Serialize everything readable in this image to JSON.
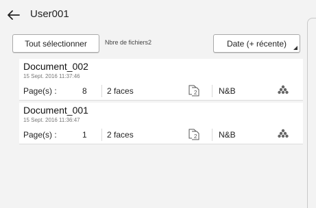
{
  "header": {
    "title": "User001",
    "back_icon": "arrow-left-icon"
  },
  "toolbar": {
    "select_all_label": "Tout sélectionner",
    "file_count_label": "Nbre de fichiers2",
    "sort_label": "Date (+ récente)"
  },
  "documents": [
    {
      "name": "Document_002",
      "date": "15 Sept. 2016 11:37:46",
      "pages_label": "Page(s) :",
      "pages": "8",
      "sides": "2 faces",
      "color_mode": "N&B",
      "duplex_icon": "duplex-icon",
      "color_icon": "dots-cluster-icon"
    },
    {
      "name": "Document_001",
      "date": "15 Sept. 2016 11:36:47",
      "pages_label": "Page(s) :",
      "pages": "1",
      "sides": "2 faces",
      "color_mode": "N&B",
      "duplex_icon": "duplex-icon",
      "color_icon": "dots-cluster-icon"
    }
  ]
}
